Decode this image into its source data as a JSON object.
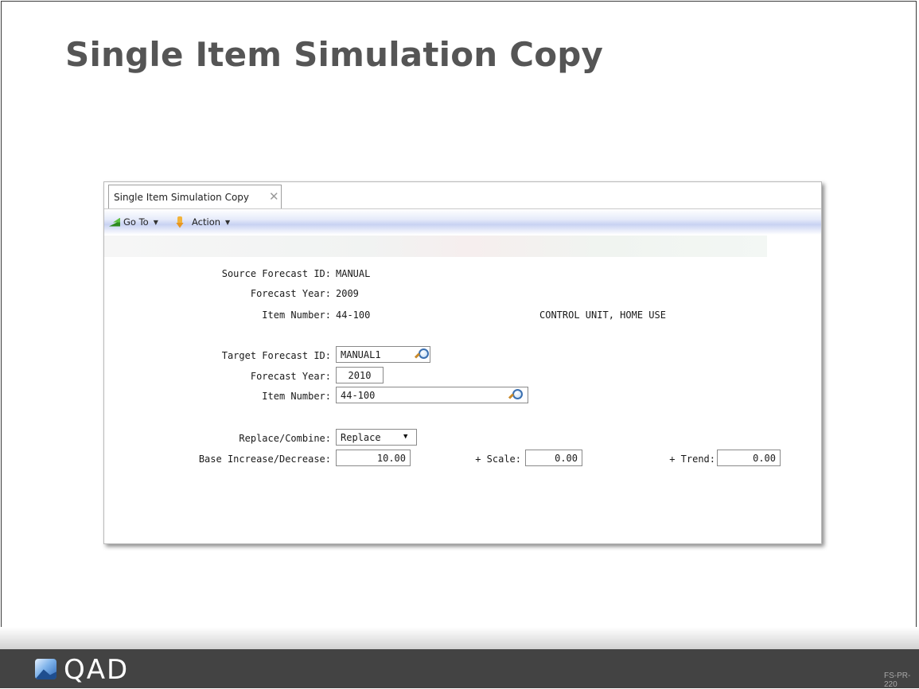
{
  "slide": {
    "title": "Single Item Simulation Copy",
    "doc_code": "FS-PR-220"
  },
  "window": {
    "tab": {
      "label": "Single Item Simulation Copy",
      "close_symbol": "✕"
    },
    "toolbar": {
      "goto_label": "Go To",
      "action_label": "Action",
      "caret": "▼"
    }
  },
  "form": {
    "source_forecast_id": {
      "label": "Source Forecast ID:",
      "value": "MANUAL"
    },
    "source_forecast_year": {
      "label": "Forecast Year:",
      "value": "2009"
    },
    "source_item_number": {
      "label": "Item Number:",
      "value": "44-100",
      "description": "CONTROL UNIT, HOME USE"
    },
    "target_forecast_id": {
      "label": "Target Forecast ID:",
      "value": "MANUAL1"
    },
    "target_forecast_year": {
      "label": "Forecast Year:",
      "value": "2010"
    },
    "target_item_number": {
      "label": "Item Number:",
      "value": "44-100"
    },
    "replace_combine": {
      "label": "Replace/Combine:",
      "value": "Replace"
    },
    "base_increase": {
      "label": "Base Increase/Decrease:",
      "value": "10.00"
    },
    "scale": {
      "label": "+ Scale:",
      "value": "0.00"
    },
    "trend": {
      "label": "+ Trend:",
      "value": "0.00"
    }
  },
  "footer": {
    "logo_text": "QAD"
  },
  "icons": {
    "goto": "goto-icon",
    "action": "action-icon",
    "lookup": "lookup-icon",
    "close": "close-icon",
    "dropdown": "chevron-down-icon",
    "logo": "qad-logo-icon"
  }
}
